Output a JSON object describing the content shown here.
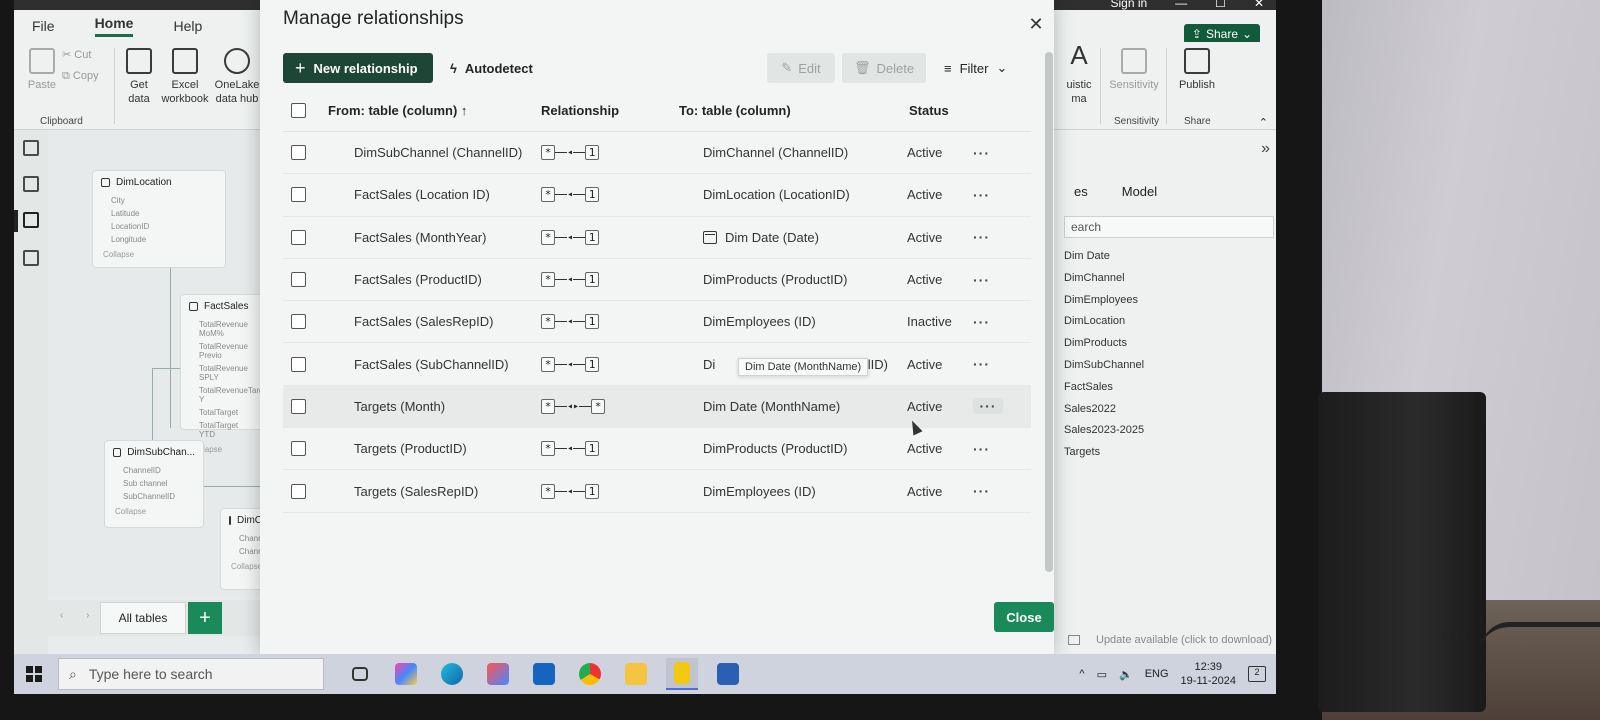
{
  "app": {
    "title_bar": {
      "sign_in": "Sign in"
    },
    "ribbon_tabs": [
      "File",
      "Home",
      "Help"
    ],
    "ribbon": {
      "cut": "Cut",
      "copy": "Copy",
      "paste": "Paste",
      "clipboard_group": "Clipboard",
      "get_data": "Get data",
      "excel_workbook": "Excel workbook",
      "onelake": "OneLake data hub",
      "linguistic": "uistic",
      "linguistic2": "ma",
      "sensitivity": "Sensitivity",
      "sensitivity_group": "Sensitivity",
      "publish": "Publish",
      "share_group": "Share",
      "share_button": "Share"
    }
  },
  "canvas": {
    "cards": [
      {
        "title": "DimLocation",
        "fields": [
          "City",
          "Latitude",
          "LocationID",
          "Longitude"
        ],
        "footer": "Collapse"
      },
      {
        "title": "FactSales",
        "fields": [
          "TotalRevenue MoM%",
          "TotalRevenue Previo",
          "TotalRevenue SPLY",
          "TotalRevenueTarget Y",
          "TotalTarget",
          "TotalTarget YTD"
        ],
        "footer": "Collapse"
      },
      {
        "title": "DimSubChan...",
        "fields": [
          "ChannelID",
          "Sub channel",
          "SubChannelID"
        ],
        "footer": "Collapse"
      },
      {
        "title": "DimChan",
        "fields": [
          "Channel",
          "ChannelID"
        ],
        "footer": "Collapse"
      }
    ],
    "bottom_tab": "All tables",
    "add_tab": "+"
  },
  "data_pane": {
    "tabs": [
      "es",
      "Model"
    ],
    "search_placeholder": "earch",
    "tables": [
      "Dim Date",
      "DimChannel",
      "DimEmployees",
      "DimLocation",
      "DimProducts",
      "DimSubChannel",
      "FactSales",
      "Sales2022",
      "Sales2023-2025",
      "Targets"
    ],
    "update_text": "Update available (click to download)"
  },
  "dialog": {
    "title": "Manage relationships",
    "new_relationship": "New relationship",
    "autodetect": "Autodetect",
    "edit": "Edit",
    "delete": "Delete",
    "filter": "Filter",
    "close_button": "Close",
    "columns": {
      "from": "From: table (column)",
      "relationship": "Relationship",
      "to": "To: table (column)",
      "status": "Status"
    },
    "rows": [
      {
        "from": "DimSubChannel (ChannelID)",
        "left": "*",
        "arrow": "◂",
        "right": "1",
        "to": "DimChannel (ChannelID)",
        "status": "Active",
        "more": "···"
      },
      {
        "from": "FactSales (Location ID)",
        "left": "*",
        "arrow": "◂",
        "right": "1",
        "to": "DimLocation (LocationID)",
        "status": "Active",
        "more": "···"
      },
      {
        "from": "FactSales (MonthYear)",
        "left": "*",
        "arrow": "◂",
        "right": "1",
        "to": "Dim Date (Date)",
        "status": "Active",
        "more": "···",
        "to_icon": "calendar-icon"
      },
      {
        "from": "FactSales (ProductID)",
        "left": "*",
        "arrow": "◂",
        "right": "1",
        "to": "DimProducts (ProductID)",
        "status": "Active",
        "more": "···"
      },
      {
        "from": "FactSales (SalesRepID)",
        "left": "*",
        "arrow": "◂",
        "right": "1",
        "to": "DimEmployees (ID)",
        "status": "Inactive",
        "more": "···"
      },
      {
        "from": "FactSales (SubChannelID)",
        "left": "*",
        "arrow": "◂",
        "right": "1",
        "to": "Di",
        "to_tail": "nelID)",
        "status": "Active",
        "more": "···"
      },
      {
        "from": "Targets (Month)",
        "left": "*",
        "arrow": "◂▸",
        "right": "*",
        "to": "Dim Date (MonthName)",
        "status": "Active",
        "more": "···",
        "highlight": true
      },
      {
        "from": "Targets (ProductID)",
        "left": "*",
        "arrow": "◂",
        "right": "1",
        "to": "DimProducts (ProductID)",
        "status": "Active",
        "more": "···"
      },
      {
        "from": "Targets (SalesRepID)",
        "left": "*",
        "arrow": "◂",
        "right": "1",
        "to": "DimEmployees (ID)",
        "status": "Active",
        "more": "···"
      }
    ],
    "tooltip": "Dim Date (MonthName)"
  },
  "taskbar": {
    "search_placeholder": "Type here to search",
    "lang": "ENG",
    "time": "12:39",
    "date": "19-11-2024",
    "notifications": "2"
  },
  "colors": {
    "primary_green": "#1b8a5a",
    "dark_green": "#1d4636"
  }
}
